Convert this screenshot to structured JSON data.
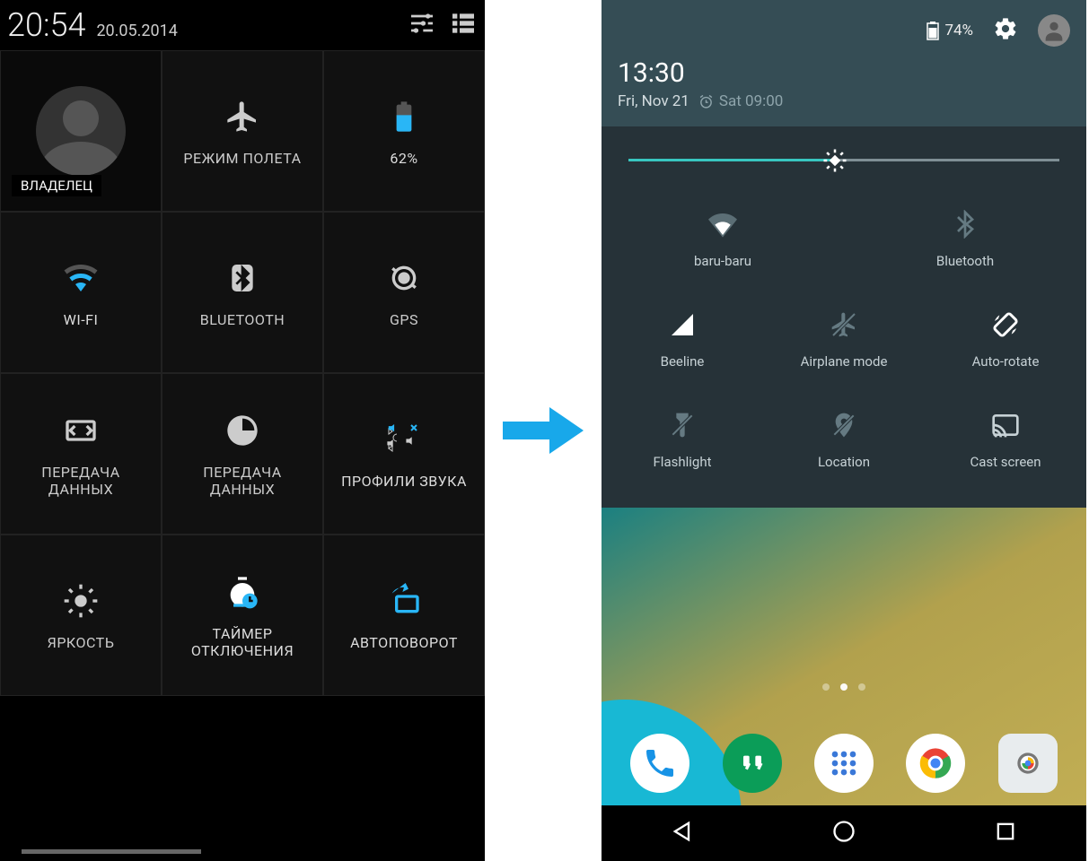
{
  "left": {
    "status": {
      "time": "20:54",
      "date": "20.05.2014"
    },
    "tiles": [
      {
        "id": "owner",
        "label": "ВЛАДЕЛЕЦ"
      },
      {
        "id": "airplane",
        "label": "РЕЖИМ ПОЛЕТА"
      },
      {
        "id": "battery",
        "label": "62%"
      },
      {
        "id": "wifi",
        "label": "WI-FI"
      },
      {
        "id": "bluetooth",
        "label": "BLUETOOTH"
      },
      {
        "id": "gps",
        "label": "GPS"
      },
      {
        "id": "data1",
        "label": "ПЕРЕДАЧА ДАННЫХ"
      },
      {
        "id": "data2",
        "label": "ПЕРЕДАЧА ДАННЫХ"
      },
      {
        "id": "sound",
        "label": "ПРОФИЛИ ЗВУКА"
      },
      {
        "id": "brightness",
        "label": "ЯРКОСТЬ"
      },
      {
        "id": "timer",
        "label": "ТАЙМЕР ОТКЛЮЧЕНИЯ"
      },
      {
        "id": "rotate",
        "label": "АВТОПОВОРОТ"
      }
    ]
  },
  "right": {
    "header": {
      "battery": "74%",
      "time": "13:30",
      "date": "Fri, Nov 21",
      "alarm": "Sat 09:00"
    },
    "brightness_percent": 48,
    "tiles_row1": [
      {
        "id": "wifi",
        "label": "baru-baru"
      },
      {
        "id": "bluetooth",
        "label": "Bluetooth"
      }
    ],
    "tiles_row2": [
      {
        "id": "cell",
        "label": "Beeline"
      },
      {
        "id": "airplane",
        "label": "Airplane mode"
      },
      {
        "id": "rotate",
        "label": "Auto-rotate"
      }
    ],
    "tiles_row3": [
      {
        "id": "flash",
        "label": "Flashlight"
      },
      {
        "id": "location",
        "label": "Location"
      },
      {
        "id": "cast",
        "label": "Cast screen"
      }
    ]
  }
}
